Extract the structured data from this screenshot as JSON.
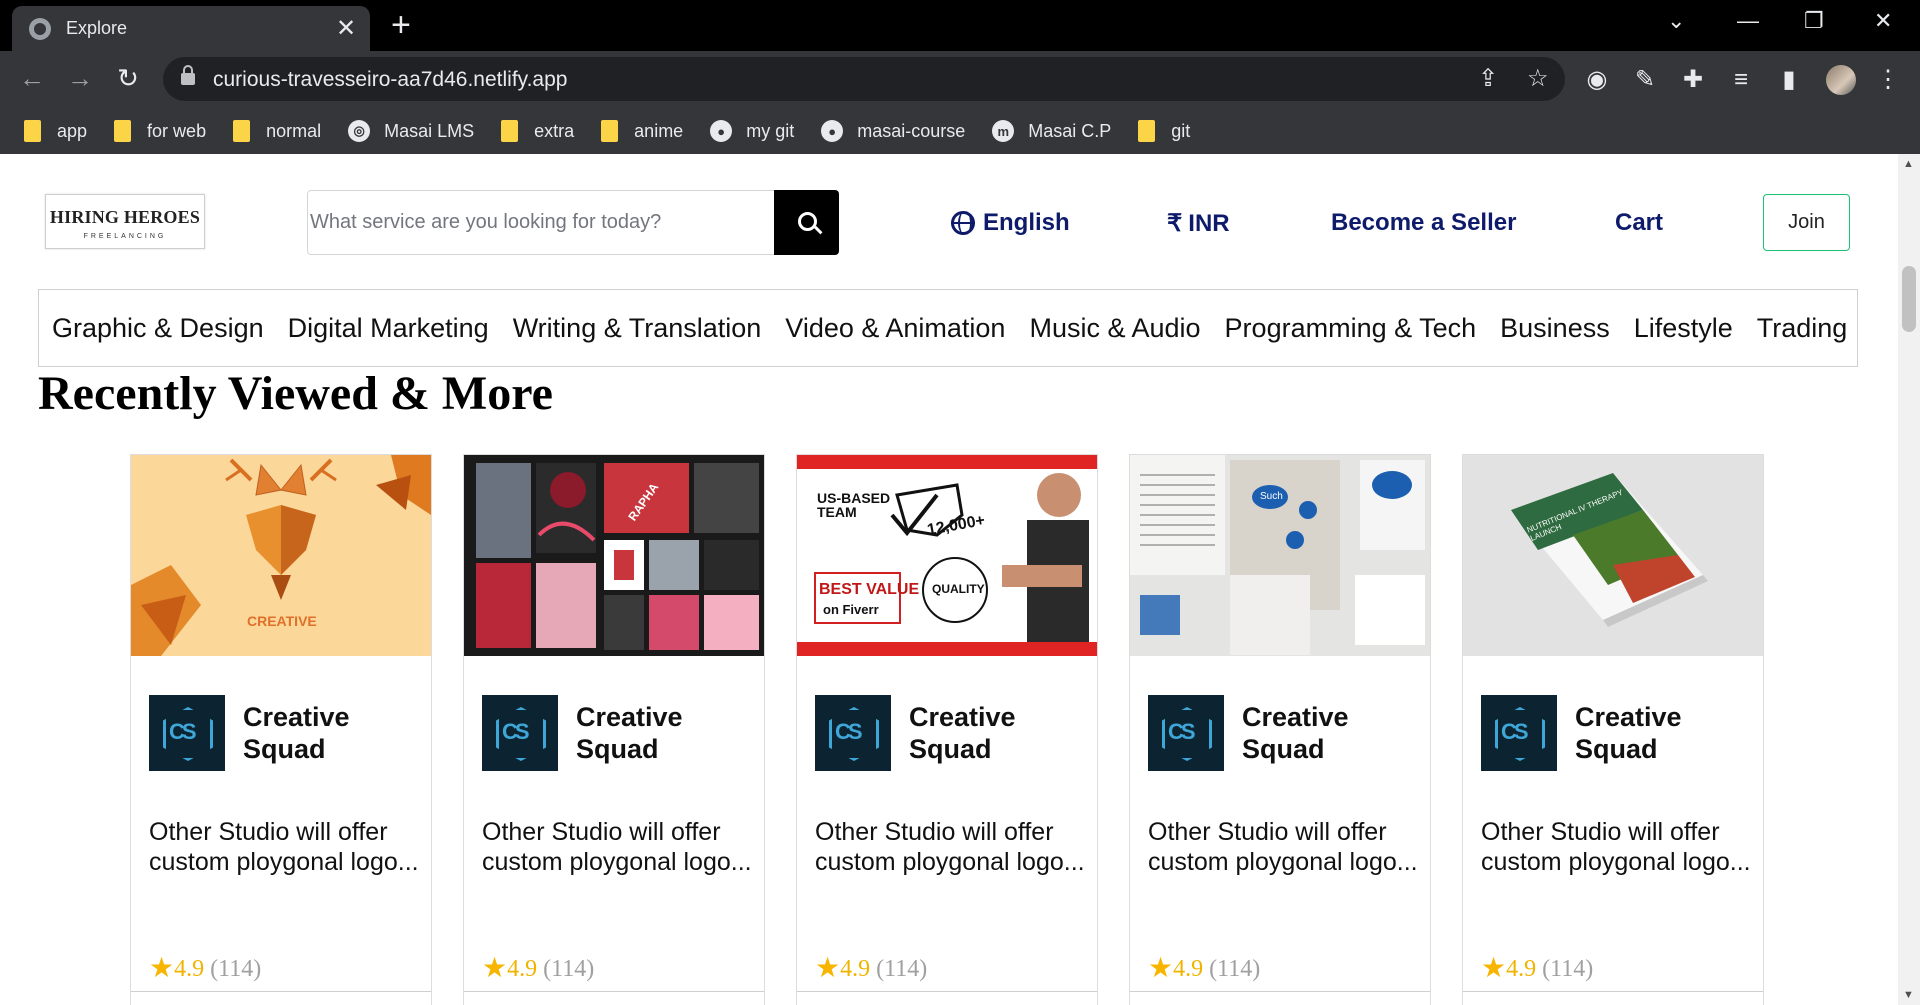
{
  "browser": {
    "tab_title": "Explore",
    "url": "curious-travesseiro-aa7d46.netlify.app",
    "bookmarks": [
      {
        "label": "app",
        "icon": "folder-icon"
      },
      {
        "label": "for web",
        "icon": "folder-icon"
      },
      {
        "label": "normal",
        "icon": "folder-icon"
      },
      {
        "label": "Masai LMS",
        "icon": "globe-icon"
      },
      {
        "label": "extra",
        "icon": "folder-icon"
      },
      {
        "label": "anime",
        "icon": "folder-icon"
      },
      {
        "label": "my git",
        "icon": "github-icon"
      },
      {
        "label": "masai-course",
        "icon": "github-icon"
      },
      {
        "label": "Masai C.P",
        "icon": "m-icon"
      },
      {
        "label": "git",
        "icon": "folder-icon"
      }
    ]
  },
  "header": {
    "logo_main": "HIRING HEROES",
    "logo_sub": "FREELANCING",
    "search_placeholder": "What service are you looking for today?",
    "language": "English",
    "currency": "INR",
    "become_seller": "Become a Seller",
    "cart": "Cart",
    "join": "Join"
  },
  "categories": [
    "Graphic & Design",
    "Digital Marketing",
    "Writing & Translation",
    "Video & Animation",
    "Music & Audio",
    "Programming & Tech",
    "Business",
    "Lifestyle",
    "Trading"
  ],
  "section_title": "Recently Viewed & More",
  "cards": [
    {
      "seller": "Creative Squad",
      "title": "Other Studio will offer custom ploygonal logo...",
      "rating": "4.9",
      "reviews": "(114)",
      "image_text": "CREATIVE"
    },
    {
      "seller": "Creative Squad",
      "title": "Other Studio will offer custom ploygonal logo...",
      "rating": "4.9",
      "reviews": "(114)",
      "image_text": "RAPHA"
    },
    {
      "seller": "Creative Squad",
      "title": "Other Studio will offer custom ploygonal logo...",
      "rating": "4.9",
      "reviews": "(114)",
      "image_text": "US-BASED TEAM"
    },
    {
      "seller": "Creative Squad",
      "title": "Other Studio will offer custom ploygonal logo...",
      "rating": "4.9",
      "reviews": "(114)",
      "image_text": "Such"
    },
    {
      "seller": "Creative Squad",
      "title": "Other Studio will offer custom ploygonal logo...",
      "rating": "4.9",
      "reviews": "(114)",
      "image_text": "NUTRITIONAL IV THERAPY LAUNCH"
    }
  ],
  "colors": {
    "nav_link": "#0e1b6b",
    "join_border": "#1dbf73",
    "star": "#f7b500"
  }
}
